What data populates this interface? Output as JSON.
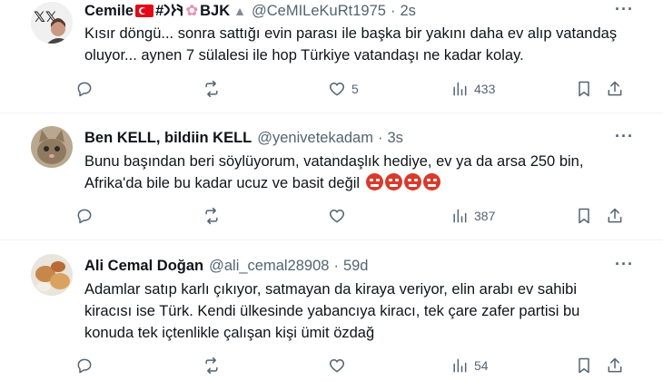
{
  "tweets": [
    {
      "name_prefix": "Cemile",
      "name_mid": "#𐰚𐰆𐰣",
      "name_suffix": "BJK",
      "handle": "@CeMILeKuRt1975",
      "dot": "·",
      "time": "2s",
      "text": "Kısır döngü... sonra sattığı evin parası ile başka bir yakını daha ev alıp vatandaş oluyor... aynen 7 sülalesi ile hop Türkiye vatandaşı ne kadar kolay.",
      "replies": "",
      "retweets": "",
      "likes": "5",
      "views": "433"
    },
    {
      "name": "Ben KELL, bildiin KELL",
      "handle": "@yenivetekadam",
      "dot": "·",
      "time": "3s",
      "text_line1": "Bunu başından beri söylüyorum, vatandaşlık hediye,  ev ya da arsa 250 bin,",
      "text_line2": "Afrika'da bile bu kadar ucuz ve basit değil",
      "replies": "",
      "retweets": "",
      "likes": "",
      "views": "387"
    },
    {
      "name": "Ali Cemal Doğan",
      "handle": "@ali_cemal28908",
      "dot": "·",
      "time": "59d",
      "text": "Adamlar satıp karlı çıkıyor, satmayan da kiraya veriyor, elin arabı ev sahibi kiracısı ise Türk. Kendi ülkesinde yabancıya kiracı, tek çare zafer partisi bu konuda tek içtenlikle çalışan kişi ümit özdağ",
      "replies": "",
      "retweets": "",
      "likes": "",
      "views": "54"
    }
  ],
  "more_label": "···",
  "icons": {
    "reply": "reply-icon",
    "retweet": "retweet-icon",
    "like": "heart-icon",
    "views": "views-icon",
    "bookmark": "bookmark-icon",
    "share": "share-icon"
  }
}
